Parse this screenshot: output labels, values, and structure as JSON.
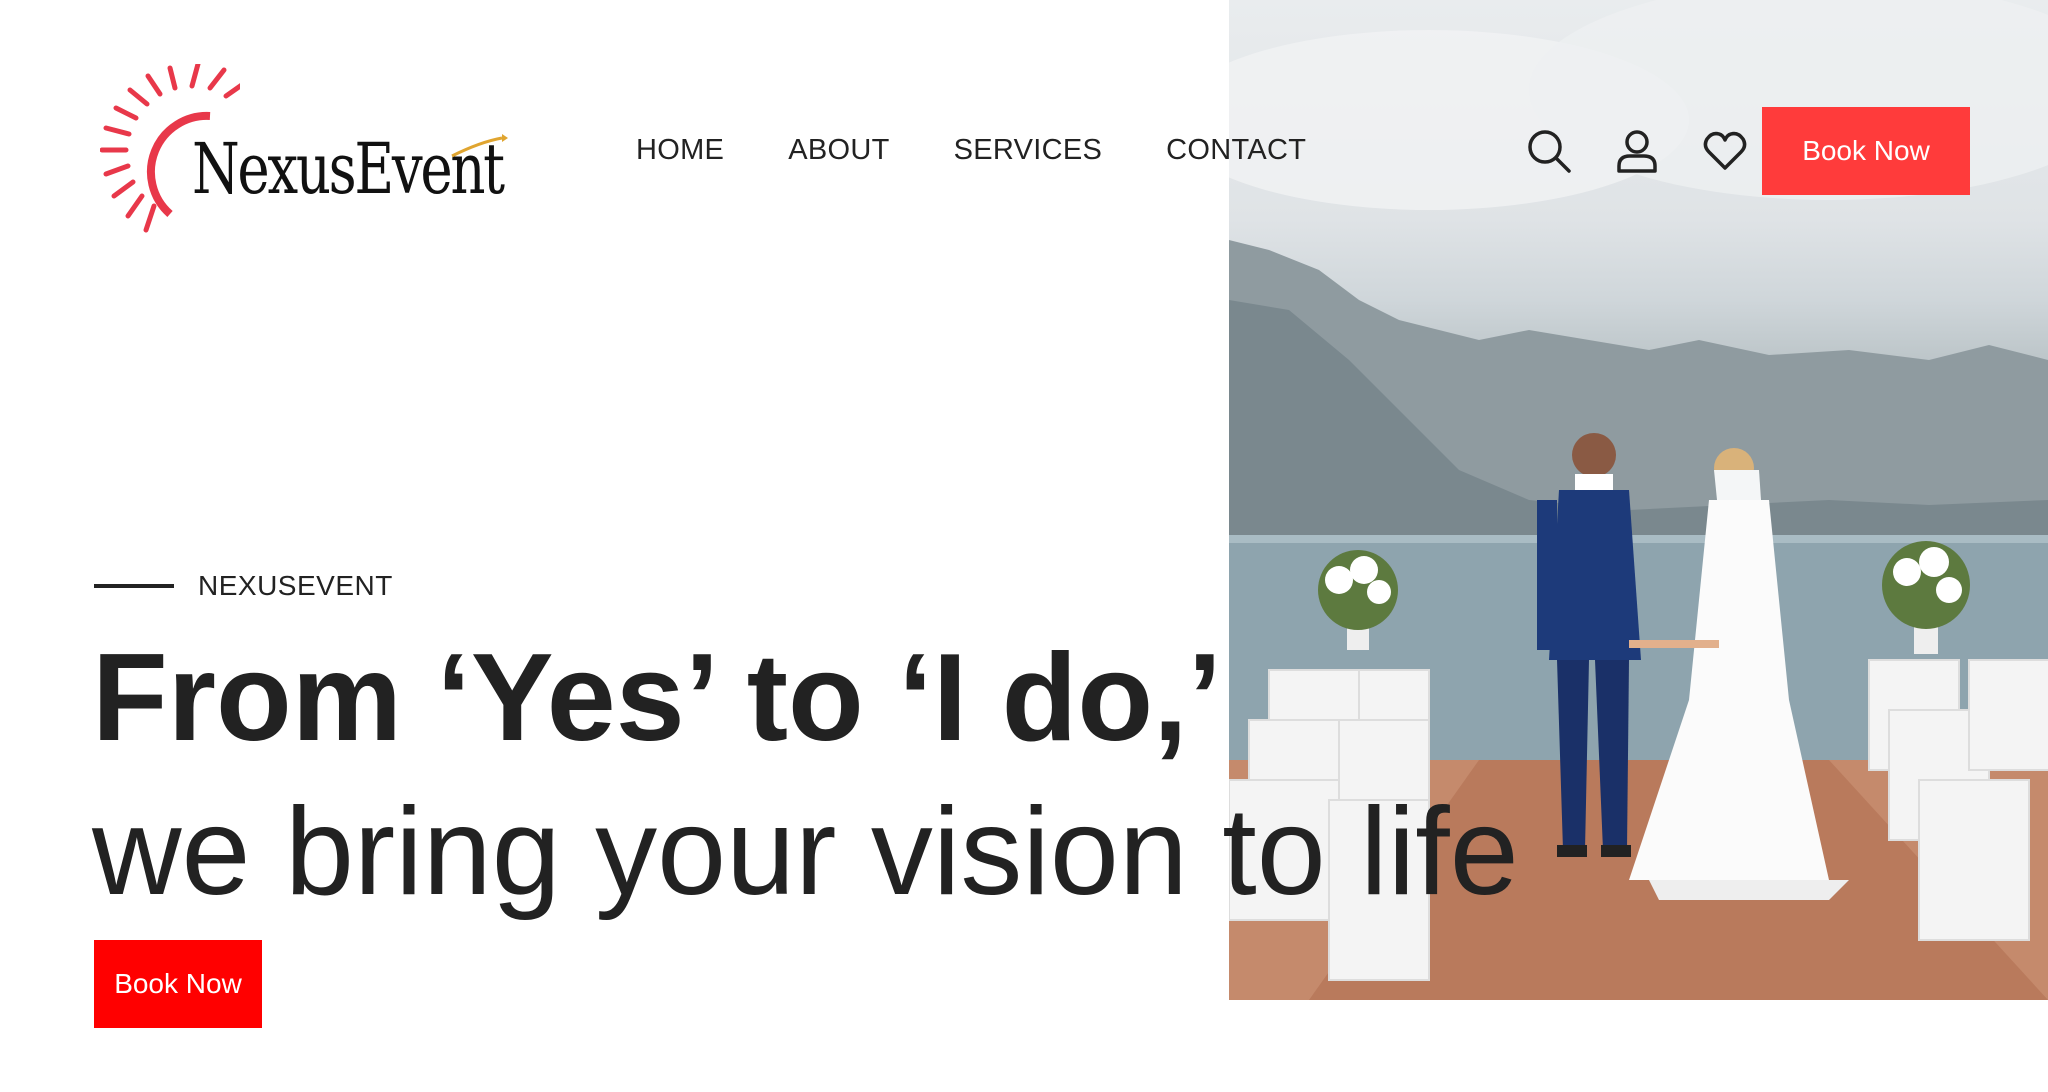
{
  "brand": {
    "logo_text": "NexusEvent"
  },
  "nav": {
    "items": [
      "HOME",
      "ABOUT",
      "SERVICES",
      "CONTACT"
    ]
  },
  "header_icons": [
    "search-icon",
    "user-icon",
    "heart-icon"
  ],
  "header": {
    "book_now_label": "Book Now"
  },
  "hero": {
    "eyebrow": "NEXUSEVENT",
    "headline_line1": "From ‘Yes’ to ‘I do,’",
    "headline_line2": "we bring your vision to life",
    "cta_label": "Book Now"
  },
  "colors": {
    "accent_header_button": "#ff3b3b",
    "accent_hero_button": "#ff0000",
    "text": "#222222",
    "logo_sun": "#e8384a"
  }
}
